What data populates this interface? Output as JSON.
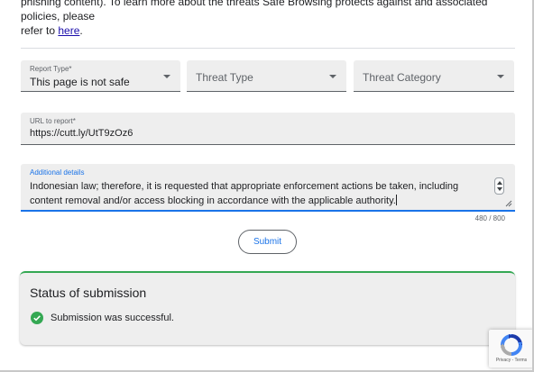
{
  "intro": {
    "line1": "phishing content). To learn more about the threats Safe Browsing protects against and associated policies, please",
    "line2_prefix": "refer to ",
    "link_text": "here",
    "line2_suffix": "."
  },
  "form": {
    "report_type": {
      "label": "Report Type*",
      "value": "This page is not safe"
    },
    "threat_type": {
      "placeholder": "Threat Type"
    },
    "threat_category": {
      "placeholder": "Threat Category"
    },
    "url": {
      "label": "URL to report*",
      "value": "https://cutt.ly/UtT9zOz6"
    },
    "details": {
      "label": "Additional details",
      "value": "Indonesian law; therefore, it is requested that appropriate enforcement actions be taken, including content removal and/or access blocking in accordance with the applicable authority.",
      "char_count": "480 / 800"
    },
    "submit_label": "Submit"
  },
  "status": {
    "title": "Status of submission",
    "message": "Submission was successful."
  },
  "recaptcha": {
    "links": "Privacy - Terms"
  },
  "colors": {
    "accent": "#1a73e8",
    "success": "#34a853",
    "field_bg": "#eeeeee"
  }
}
